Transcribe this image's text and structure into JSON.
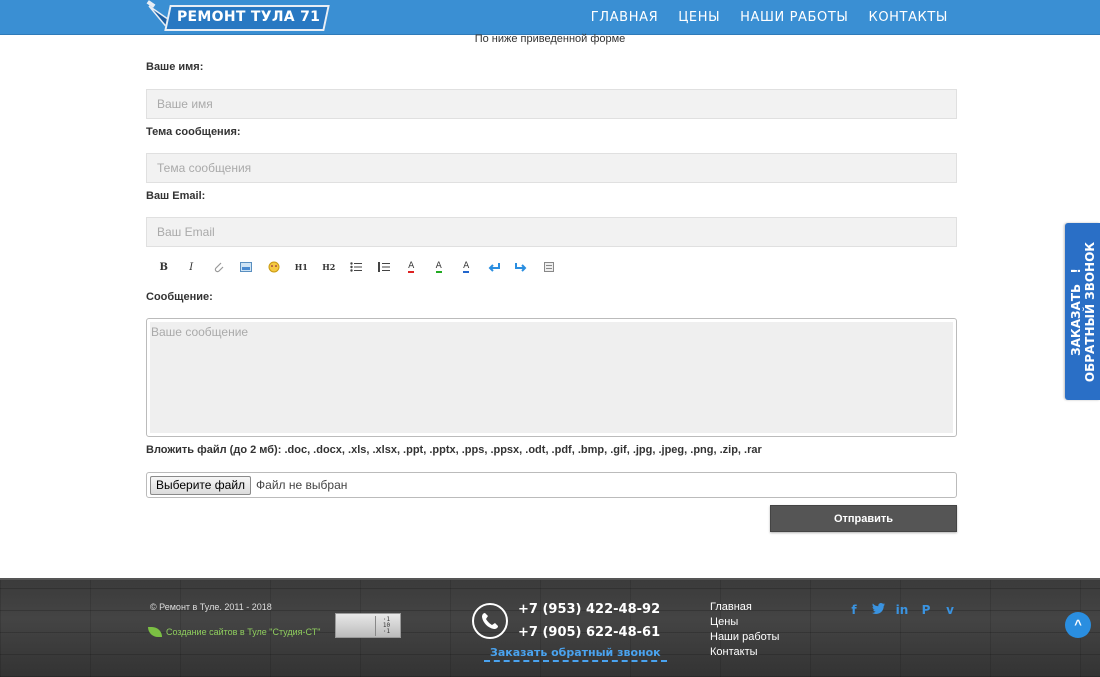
{
  "header": {
    "logo_text": "РЕМОНТ ТУЛА 71",
    "nav": [
      "ГЛАВНАЯ",
      "ЦЕНЫ",
      "НАШИ РАБОТЫ",
      "КОНТАКТЫ"
    ]
  },
  "intro": "По ниже приведенной форме",
  "form": {
    "name_label": "Ваше имя:",
    "name_placeholder": "Ваше имя",
    "subject_label": "Тема сообщения:",
    "subject_placeholder": "Тема сообщения",
    "email_label": "Ваш Email:",
    "email_placeholder": "Ваш Email",
    "toolbar": [
      "B",
      "I",
      "link",
      "image",
      "emoji",
      "H1",
      "H2",
      "ul",
      "ol",
      "A-red",
      "A-green",
      "A-blue",
      "undo",
      "redo",
      "source"
    ],
    "message_label": "Сообщение:",
    "message_placeholder": "Ваше сообщение",
    "attach_label": "Вложить файл (до 2 мб):",
    "attach_types": ".doc, .docx, .xls, .xlsx, .ppt, .pptx, .pps, .ppsx, .odt, .pdf, .bmp, .gif, .jpg, .jpeg, .png, .zip, .rar",
    "file_button": "Выберите файл",
    "file_status": "Файл не выбран",
    "submit": "Отправить"
  },
  "side_tab": {
    "line1": "ЗАКАЗАТЬ",
    "line2": "ОБРАТНЫЙ ЗВОНОК",
    "mark": "!"
  },
  "footer": {
    "copyright": "© Ремонт в Туле. 2011 - 2018",
    "studio": "Создание сайтов в Туле \"Студия-СТ\"",
    "phone1": "+7 (953) 422-48-92",
    "phone2": "+7 (905) 622-48-61",
    "callback": "Заказать обратный звонок",
    "nav": [
      "Главная",
      "Цены",
      "Наши работы",
      "Контакты"
    ],
    "socials": [
      "facebook-icon",
      "twitter-icon",
      "linkedin-icon",
      "pinterest-icon",
      "vimeo-icon"
    ],
    "to_top": "^"
  },
  "colors": {
    "header": "#3a8fd3",
    "accent": "#2a8ee0",
    "submit": "#555555",
    "footer": "#3b3b3b"
  }
}
